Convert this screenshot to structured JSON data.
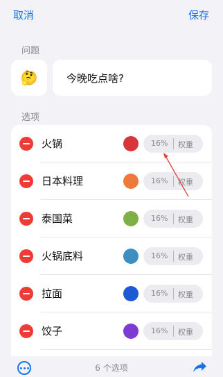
{
  "topbar": {
    "cancel_label": "取消",
    "save_label": "保存"
  },
  "question_section": {
    "label": "问题",
    "emoji": "🤔",
    "text": "今晚吃点啥?"
  },
  "options_section": {
    "label": "选项",
    "weight_label": "权重",
    "items": [
      {
        "name": "火锅",
        "color": "#d7353a",
        "percent": "16%"
      },
      {
        "name": "日本料理",
        "color": "#ec7a3c",
        "percent": "16%"
      },
      {
        "name": "泰国菜",
        "color": "#7fb045",
        "percent": "16%"
      },
      {
        "name": "火锅底料",
        "color": "#3c8fc0",
        "percent": "16%"
      },
      {
        "name": "拉面",
        "color": "#1c5ad6",
        "percent": "16%"
      },
      {
        "name": "饺子",
        "color": "#7d3bd0",
        "percent": "16%"
      }
    ]
  },
  "bottombar": {
    "count_text": "6 个选项"
  },
  "icons": {
    "more": "more-icon",
    "share": "share-icon",
    "remove": "minus-circle-icon"
  },
  "accent_color": "#1a73e8",
  "annotation_color": "#e0453a"
}
